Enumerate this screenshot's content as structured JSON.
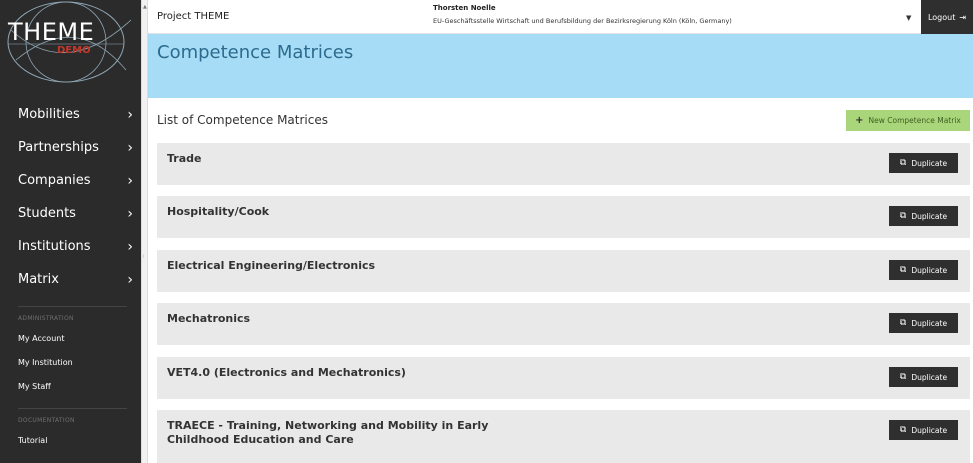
{
  "logo": {
    "title": "THEME",
    "subtitle": "DEMO"
  },
  "sidebar": {
    "items": [
      {
        "label": "Mobilities"
      },
      {
        "label": "Partnerships"
      },
      {
        "label": "Companies"
      },
      {
        "label": "Students"
      },
      {
        "label": "Institutions"
      },
      {
        "label": "Matrix"
      }
    ],
    "administration_label": "ADMINISTRATION",
    "admin_items": [
      {
        "label": "My Account"
      },
      {
        "label": "My Institution"
      },
      {
        "label": "My Staff"
      }
    ],
    "documentation_label": "DOCUMENTATION",
    "doc_items": [
      {
        "label": "Tutorial"
      }
    ]
  },
  "topbar": {
    "project": "Project THEME",
    "user_name": "Thorsten Noelle",
    "user_org": "EU-Geschäftsstelle Wirtschaft und Berufsbildung der Bezirksregierung Köln (Köln, Germany)",
    "logout_label": "Logout"
  },
  "hero": {
    "title": "Competence Matrices"
  },
  "main": {
    "list_title": "List of Competence Matrices",
    "new_button_label": "New Competence Matrix",
    "duplicate_label": "Duplicate",
    "matrices": [
      {
        "title": "Trade"
      },
      {
        "title": "Hospitality/Cook"
      },
      {
        "title": "Electrical Engineering/Electronics"
      },
      {
        "title": "Mechatronics"
      },
      {
        "title": "VET4.0 (Electronics and Mechatronics)"
      },
      {
        "title": "TRAECE - Training, Networking and Mobility in Early Childhood Education and Care"
      }
    ]
  },
  "colors": {
    "sidebar_bg": "#2b2b2b",
    "hero_bg": "#a6dcf5",
    "hero_text": "#2c6b8e",
    "new_button_bg": "#a9d67a",
    "card_bg": "#e9e9e9",
    "dark_button_bg": "#2f2f2f",
    "logo_accent": "#c0392b"
  },
  "icons": {
    "nav_chevron": "chevron-right-icon",
    "logout": "logout-icon",
    "new": "plus-icon",
    "duplicate": "copy-icon",
    "dropdown": "caret-down-icon"
  }
}
